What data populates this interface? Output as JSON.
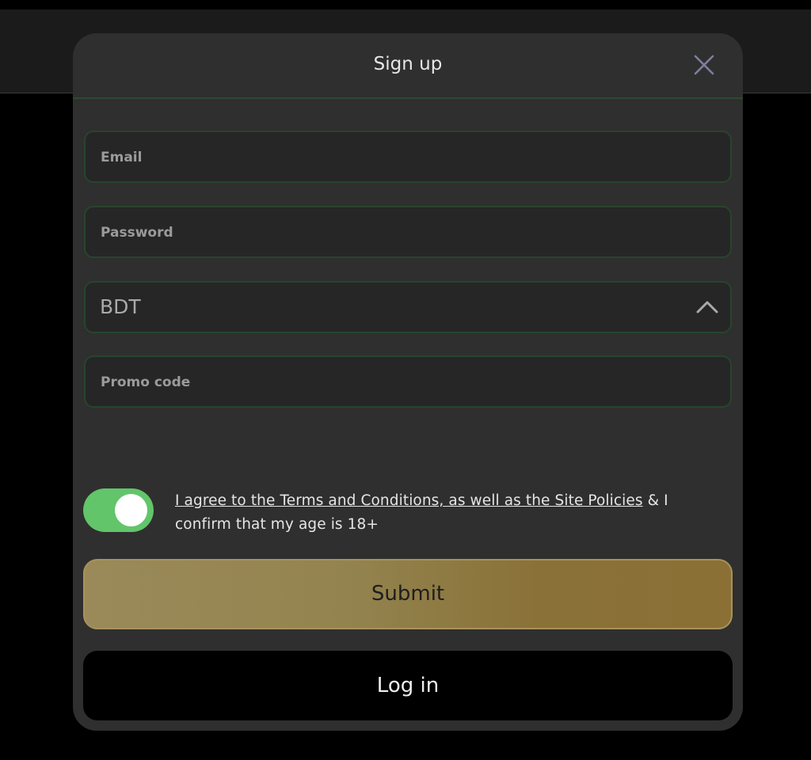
{
  "modal": {
    "title": "Sign up",
    "close_icon": "close-icon"
  },
  "form": {
    "email": {
      "placeholder": "Email",
      "value": ""
    },
    "password": {
      "placeholder": "Password",
      "value": ""
    },
    "currency": {
      "value": "BDT",
      "icon": "chevron-up-icon"
    },
    "promo": {
      "placeholder": "Promo code",
      "value": ""
    }
  },
  "agreement": {
    "toggle_on": true,
    "link_text": "I agree to the Terms and Conditions, as well as the Site Policies",
    "rest_text": " & I confirm that my age is 18+"
  },
  "buttons": {
    "submit_label": "Submit",
    "login_label": "Log in"
  },
  "colors": {
    "toggle_on": "#62c56a",
    "field_border": "#27452d",
    "submit_gradient_start": "#9a8a5a",
    "submit_gradient_end": "#8b7036"
  }
}
